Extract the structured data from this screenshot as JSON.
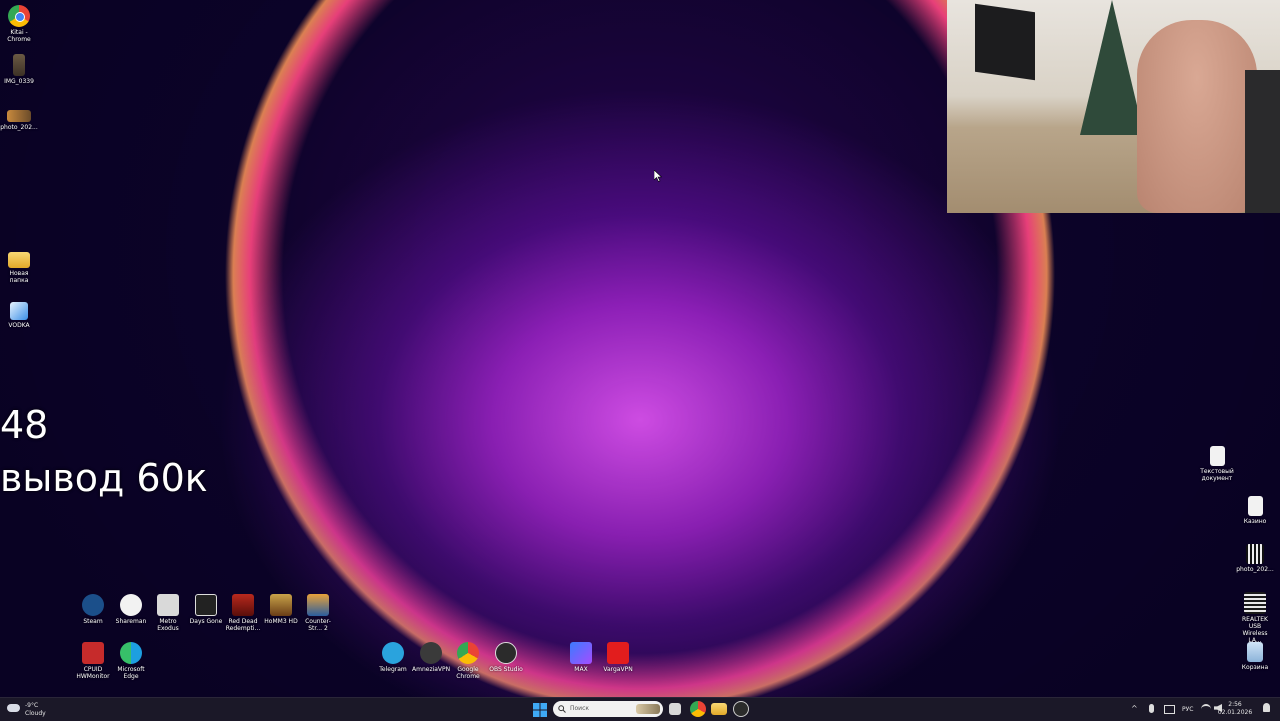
{
  "desktop_left": [
    {
      "label": "Kitai - Chrome",
      "icon": "chrome-icon"
    },
    {
      "label": "IMG_0339",
      "icon": "image-thumb-icon"
    },
    {
      "label": "photo_202...",
      "icon": "image-thumb-icon"
    },
    {
      "label": "Новая папка",
      "icon": "folder-icon"
    },
    {
      "label": "VODKA",
      "icon": "app-icon"
    }
  ],
  "overlay": {
    "line1": "48",
    "line2": "вывод 60к"
  },
  "games_row": [
    {
      "label": "Steam"
    },
    {
      "label": "Shareman"
    },
    {
      "label": "Metro Exodus"
    },
    {
      "label": "Days Gone"
    },
    {
      "label": "Red Dead Redempti..."
    },
    {
      "label": "HoMM3 HD"
    },
    {
      "label": "Counter-Str... 2"
    }
  ],
  "tools_row": [
    {
      "label": "CPUID HWMonitor"
    },
    {
      "label": "Microsoft Edge"
    }
  ],
  "apps_row": [
    {
      "label": "Telegram"
    },
    {
      "label": "AmneziaVPN"
    },
    {
      "label": "Google Chrome"
    },
    {
      "label": "OBS Studio"
    },
    {
      "label": "MAX"
    },
    {
      "label": "VargaVPN"
    }
  ],
  "desktop_right": [
    {
      "label": "Текстовый документ"
    },
    {
      "label": "Казино"
    },
    {
      "label": "photo_202..."
    },
    {
      "label": "REALTEK USB Wireless LA..."
    },
    {
      "label": "Корзина"
    }
  ],
  "taskbar": {
    "weather_temp": "-9°C",
    "weather_desc": "Cloudy",
    "search_placeholder": "Поиск",
    "lang": "РУС",
    "time": "2:56",
    "date": "02.01.2026"
  }
}
